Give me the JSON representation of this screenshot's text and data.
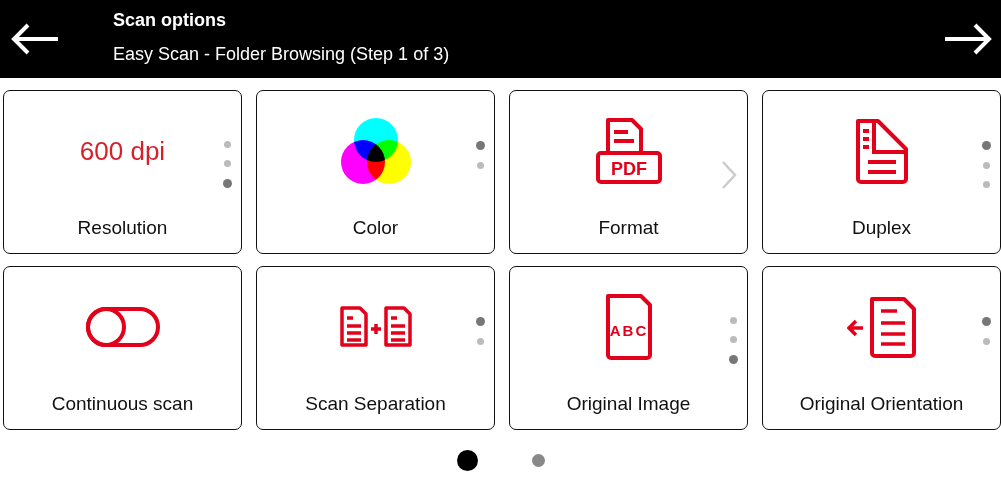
{
  "header": {
    "title": "Scan options",
    "subtitle": "Easy Scan - Folder Browsing (Step 1 of 3)"
  },
  "tiles": [
    {
      "label": "Resolution",
      "kind": "value",
      "value": "600 dpi",
      "dots": [
        {
          "selected": false
        },
        {
          "selected": false
        },
        {
          "selected": true
        }
      ]
    },
    {
      "label": "Color",
      "kind": "color",
      "dots": [
        {
          "selected": true
        },
        {
          "selected": false
        }
      ]
    },
    {
      "label": "Format",
      "kind": "pdf",
      "icon_text": "PDF",
      "chevron": true
    },
    {
      "label": "Duplex",
      "kind": "duplex",
      "dots": [
        {
          "selected": true
        },
        {
          "selected": false
        },
        {
          "selected": false
        }
      ]
    },
    {
      "label": "Continuous scan",
      "kind": "toggle"
    },
    {
      "label": "Scan Separation",
      "kind": "separation",
      "dots": [
        {
          "selected": true
        },
        {
          "selected": false
        }
      ]
    },
    {
      "label": "Original Image",
      "kind": "abc",
      "icon_text": "ABC",
      "dots": [
        {
          "selected": false
        },
        {
          "selected": false
        },
        {
          "selected": true
        }
      ]
    },
    {
      "label": "Original Orientation",
      "kind": "orientation",
      "dots": [
        {
          "selected": true
        },
        {
          "selected": false
        }
      ]
    }
  ],
  "pages": [
    {
      "selected": true
    },
    {
      "selected": false
    }
  ]
}
